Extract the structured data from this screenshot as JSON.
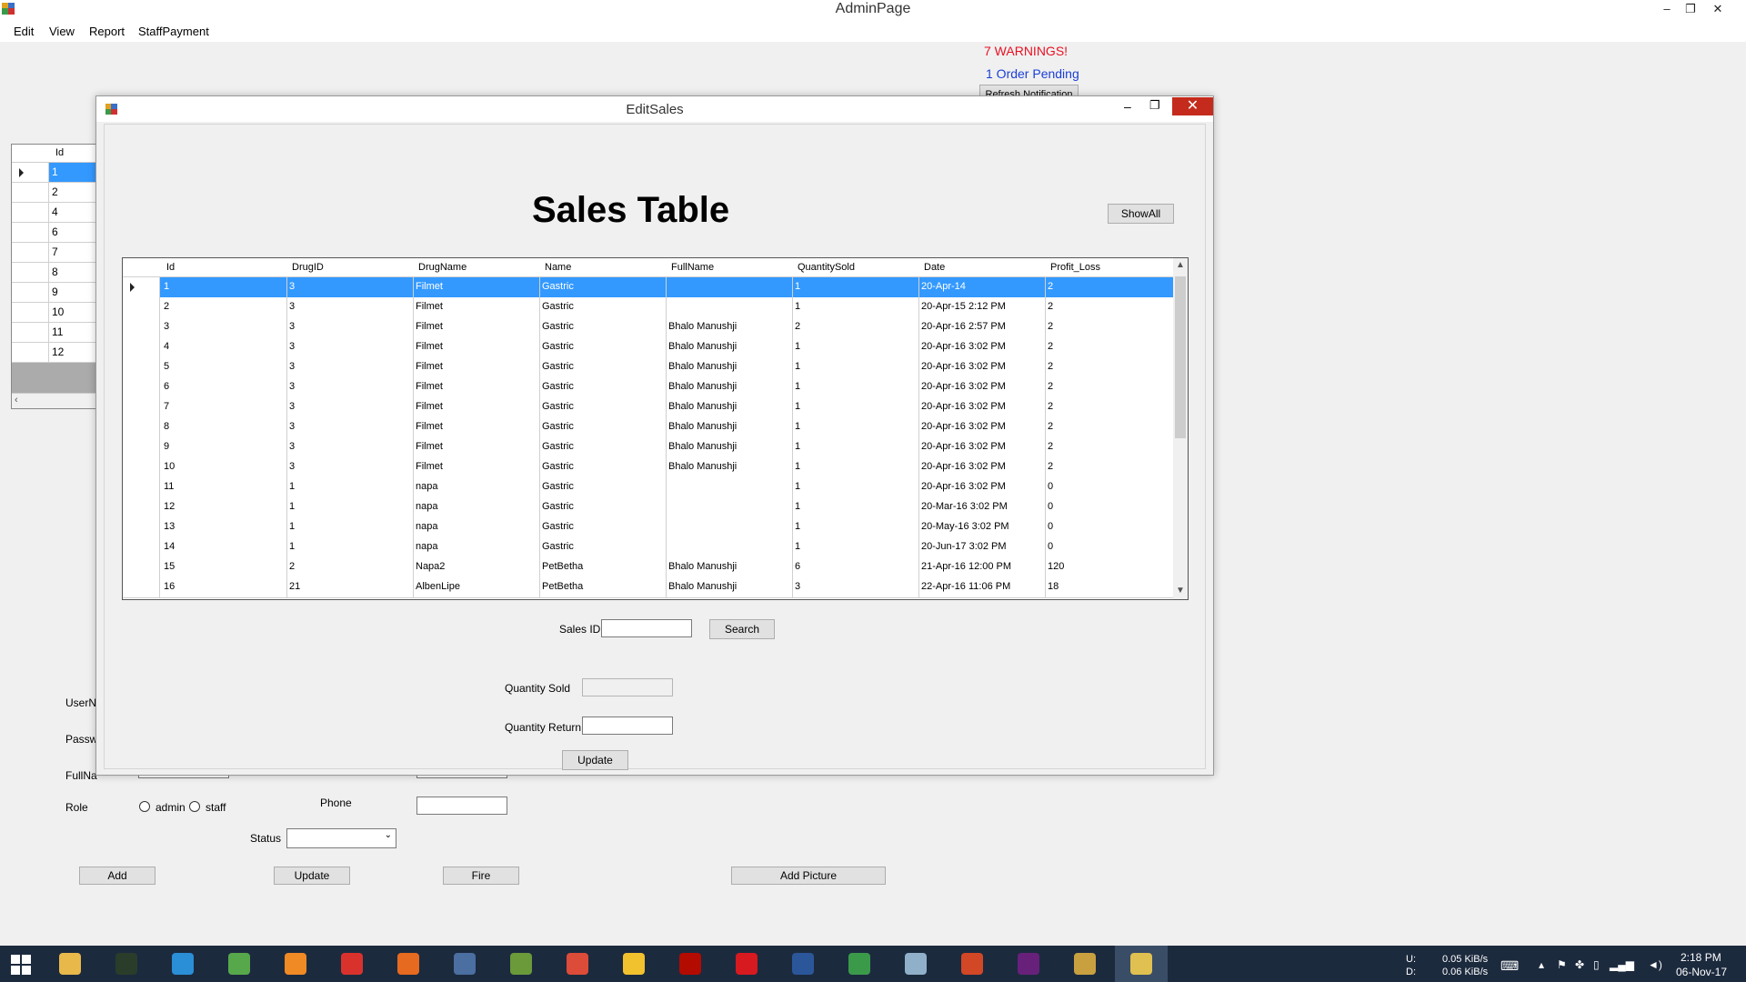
{
  "app": {
    "title": "AdminPage"
  },
  "window_controls": {
    "minimize": "–",
    "restore": "❐",
    "close": "✕"
  },
  "menu": [
    "Edit",
    "View",
    "Report",
    "StaffPayment"
  ],
  "notifications": {
    "warnings": "7 WARNINGS!",
    "pending": "1 Order Pending",
    "refresh_label": "Refresh Notification"
  },
  "bg_grid": {
    "header": "Id",
    "rows": [
      "1",
      "2",
      "4",
      "6",
      "7",
      "8",
      "9",
      "10",
      "11",
      "12"
    ]
  },
  "bg_form": {
    "username_label": "UserNa",
    "password_label": "Passw",
    "fullname_label": "FullNa",
    "role_label": "Role",
    "role_admin": "admin",
    "role_staff": "staff",
    "phone_label": "Phone",
    "status_label": "Status",
    "add_label": "Add",
    "update_label": "Update",
    "fire_label": "Fire",
    "add_picture_label": "Add Picture"
  },
  "dialog": {
    "title": "EditSales",
    "heading": "Sales Table",
    "showall_label": "ShowAll",
    "columns": [
      "Id",
      "DrugID",
      "DrugName",
      "Name",
      "FullName",
      "QuantitySold",
      "Date",
      "Profit_Loss"
    ],
    "rows": [
      [
        "1",
        "3",
        "Filmet",
        "Gastric",
        "",
        "1",
        "20-Apr-14",
        "2"
      ],
      [
        "2",
        "3",
        "Filmet",
        "Gastric",
        "",
        "1",
        "20-Apr-15 2:12 PM",
        "2"
      ],
      [
        "3",
        "3",
        "Filmet",
        "Gastric",
        "Bhalo Manushji",
        "2",
        "20-Apr-16 2:57 PM",
        "2"
      ],
      [
        "4",
        "3",
        "Filmet",
        "Gastric",
        "Bhalo Manushji",
        "1",
        "20-Apr-16 3:02 PM",
        "2"
      ],
      [
        "5",
        "3",
        "Filmet",
        "Gastric",
        "Bhalo Manushji",
        "1",
        "20-Apr-16 3:02 PM",
        "2"
      ],
      [
        "6",
        "3",
        "Filmet",
        "Gastric",
        "Bhalo Manushji",
        "1",
        "20-Apr-16 3:02 PM",
        "2"
      ],
      [
        "7",
        "3",
        "Filmet",
        "Gastric",
        "Bhalo Manushji",
        "1",
        "20-Apr-16 3:02 PM",
        "2"
      ],
      [
        "8",
        "3",
        "Filmet",
        "Gastric",
        "Bhalo Manushji",
        "1",
        "20-Apr-16 3:02 PM",
        "2"
      ],
      [
        "9",
        "3",
        "Filmet",
        "Gastric",
        "Bhalo Manushji",
        "1",
        "20-Apr-16 3:02 PM",
        "2"
      ],
      [
        "10",
        "3",
        "Filmet",
        "Gastric",
        "Bhalo Manushji",
        "1",
        "20-Apr-16 3:02 PM",
        "2"
      ],
      [
        "11",
        "1",
        "napa",
        "Gastric",
        "",
        "1",
        "20-Apr-16 3:02 PM",
        "0"
      ],
      [
        "12",
        "1",
        "napa",
        "Gastric",
        "",
        "1",
        "20-Mar-16 3:02 PM",
        "0"
      ],
      [
        "13",
        "1",
        "napa",
        "Gastric",
        "",
        "1",
        "20-May-16 3:02 PM",
        "0"
      ],
      [
        "14",
        "1",
        "napa",
        "Gastric",
        "",
        "1",
        "20-Jun-17 3:02 PM",
        "0"
      ],
      [
        "15",
        "2",
        "Napa2",
        "PetBetha",
        "Bhalo Manushji",
        "6",
        "21-Apr-16 12:00 PM",
        "120"
      ],
      [
        "16",
        "21",
        "AlbenLipe",
        "PetBetha",
        "Bhalo Manushji",
        "3",
        "22-Apr-16 11:06 PM",
        "18"
      ]
    ],
    "sales_id_label": "Sales ID",
    "search_label": "Search",
    "qty_sold_label": "Quantity Sold",
    "qty_return_label": "Quantity Return",
    "update_label": "Update"
  },
  "taskbar": {
    "upload": "U:",
    "download": "D:",
    "up_speed": "0.05 KiB/s",
    "down_speed": "0.06 KiB/s",
    "time": "2:18 PM",
    "date": "06-Nov-17",
    "apps": [
      {
        "name": "file-explorer",
        "color": "#e8b84a"
      },
      {
        "name": "monitor-app",
        "color": "#2a3d2a"
      },
      {
        "name": "teamviewer",
        "color": "#2a8fd6"
      },
      {
        "name": "globe-app",
        "color": "#57a84a"
      },
      {
        "name": "media-player",
        "color": "#f08a24"
      },
      {
        "name": "store-app",
        "color": "#d9322d"
      },
      {
        "name": "firefox",
        "color": "#e66a1f"
      },
      {
        "name": "network-app",
        "color": "#4a6fa0"
      },
      {
        "name": "notepad-app",
        "color": "#6a9a3a"
      },
      {
        "name": "chrome",
        "color": "#dd4b39"
      },
      {
        "name": "bulb-app",
        "color": "#f2c12e"
      },
      {
        "name": "acrobat",
        "color": "#b30b00"
      },
      {
        "name": "b-app",
        "color": "#d71920"
      },
      {
        "name": "word",
        "color": "#2b579a"
      },
      {
        "name": "download-app",
        "color": "#3a9a4a"
      },
      {
        "name": "paper-app",
        "color": "#8fb0c8"
      },
      {
        "name": "powerpoint",
        "color": "#d24726"
      },
      {
        "name": "visual-studio",
        "color": "#68217a"
      },
      {
        "name": "tools-app",
        "color": "#c8a040"
      },
      {
        "name": "adminpage-app",
        "color": "#e0c050"
      }
    ]
  }
}
